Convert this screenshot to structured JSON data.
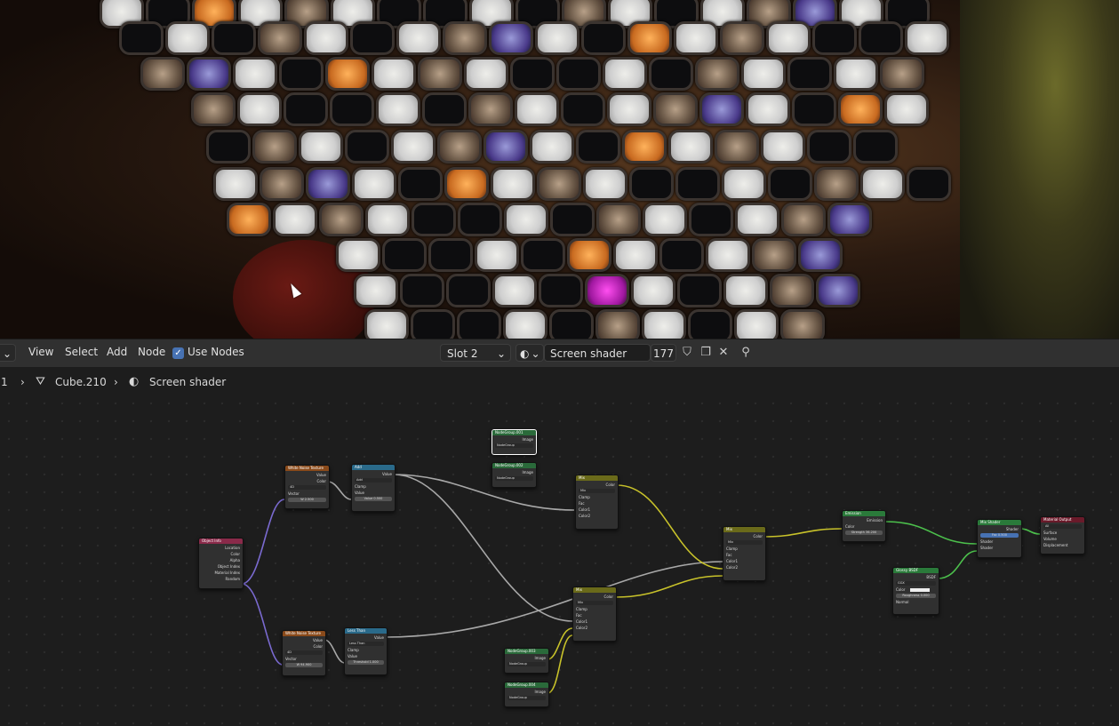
{
  "header": {
    "menu": [
      "View",
      "Select",
      "Add",
      "Node"
    ],
    "use_nodes_label": "Use Nodes",
    "slot_label": "Slot 2",
    "material_name": "Screen shader",
    "user_count": "177"
  },
  "breadcrumb": {
    "prefix": "1",
    "object": "Cube.210",
    "material": "Screen shader"
  },
  "nodes": {
    "object_info": {
      "title": "Object Info",
      "outputs": [
        "Location",
        "Color",
        "Alpha",
        "Object Index",
        "Material Index",
        "Random"
      ]
    },
    "white_noise_1": {
      "title": "White Noise Texture",
      "outputs": [
        "Value",
        "Color"
      ],
      "dim": "4D",
      "input": "Vector",
      "w_label": "W",
      "w_value": "2.500"
    },
    "add": {
      "title": "Add",
      "output": "Value",
      "op": "Add",
      "clamp": "Clamp",
      "input": "Value",
      "value_label": "Value",
      "value": "0.500"
    },
    "white_noise_2": {
      "title": "White Noise Texture",
      "outputs": [
        "Value",
        "Color"
      ],
      "dim": "4D",
      "input": "Vector",
      "w_label": "W",
      "w_value": "94.900"
    },
    "less_than": {
      "title": "Less Than",
      "output": "Value",
      "op": "Less Than",
      "clamp": "Clamp",
      "input": "Value",
      "thr_label": "Threshold",
      "thr_value": "1.000"
    },
    "group_001": {
      "title": "NodeGroup.001",
      "output": "Image",
      "field": "NodeGroup"
    },
    "group_002": {
      "title": "NodeGroup.002",
      "output": "Image",
      "field": "NodeGroup"
    },
    "group_003": {
      "title": "NodeGroup.003",
      "output": "Image",
      "field": "NodeGroup"
    },
    "group_004": {
      "title": "NodeGroup.004",
      "output": "Image",
      "field": "NodeGroup"
    },
    "mix_a": {
      "title": "Mix",
      "output": "Color",
      "mode": "Mix",
      "clamp": "Clamp",
      "inputs": [
        "Fac",
        "Color1",
        "Color2"
      ]
    },
    "mix_b": {
      "title": "Mix",
      "output": "Color",
      "mode": "Mix",
      "clamp": "Clamp",
      "inputs": [
        "Fac",
        "Color1",
        "Color2"
      ]
    },
    "mix_c": {
      "title": "Mix",
      "output": "Color",
      "mode": "Mix",
      "clamp": "Clamp",
      "inputs": [
        "Fac",
        "Color1",
        "Color2"
      ]
    },
    "emission": {
      "title": "Emission",
      "output": "Emission",
      "input": "Color",
      "str_label": "Strength",
      "str_value": "36.200"
    },
    "glossy": {
      "title": "Glossy BSDF",
      "output": "BSDF",
      "dist": "GGX",
      "color": "Color",
      "rough_label": "Roughness",
      "rough_value": "0.000",
      "normal": "Normal"
    },
    "mix_shader": {
      "title": "Mix Shader",
      "output": "Shader",
      "fac_label": "Fac",
      "fac_value": "0.500",
      "inputs": [
        "Shader",
        "Shader"
      ]
    },
    "material_output": {
      "title": "Material Output",
      "target": "All",
      "inputs": [
        "Surface",
        "Volume",
        "Displacement"
      ]
    }
  },
  "colors": {
    "accent_blue": "#4772b3",
    "wire_gray": "#a8a8a8",
    "wire_yellow": "#c8c22a",
    "wire_green": "#4cc04c",
    "wire_purple": "#7a6ad0"
  }
}
